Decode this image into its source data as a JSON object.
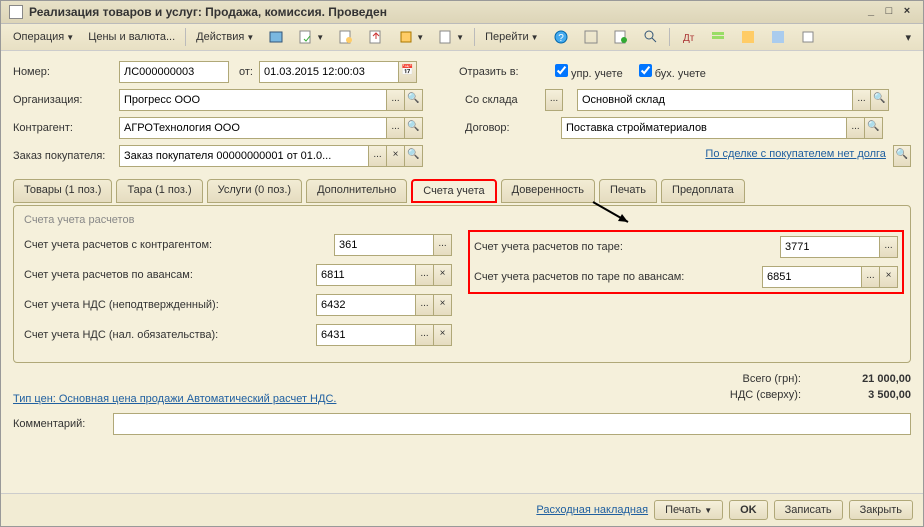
{
  "title": "Реализация товаров и услуг: Продажа, комиссия. Проведен",
  "toolbar": {
    "operation": "Операция",
    "prices": "Цены и валюта...",
    "actions": "Действия",
    "goto": "Перейти"
  },
  "header": {
    "number_label": "Номер:",
    "number": "ЛС000000003",
    "from_label": "от:",
    "date": "01.03.2015 12:00:03",
    "reflect_label": "Отразить в:",
    "mgmt_label": "упр. учете",
    "acc_label": "бух. учете",
    "org_label": "Организация:",
    "org": "Прогресс ООО",
    "warehouse_label": "Со склада",
    "warehouse": "Основной склад",
    "contractor_label": "Контрагент:",
    "contractor": "АГРОТехнология ООО",
    "contract_label": "Договор:",
    "contract": "Поставка стройматериалов",
    "order_label": "Заказ покупателя:",
    "order": "Заказ покупателя 00000000001 от 01.0...",
    "deal_link": "По сделке с покупателем нет долга"
  },
  "tabs": {
    "goods": "Товары (1 поз.)",
    "tare": "Тара (1 поз.)",
    "services": "Услуги (0 поз.)",
    "extra": "Дополнительно",
    "accounts": "Счета учета",
    "attorney": "Доверенность",
    "print": "Печать",
    "prepay": "Предоплата"
  },
  "panel": {
    "title": "Счета учета расчетов",
    "acc_contractor_label": "Счет учета расчетов с контрагентом:",
    "acc_contractor": "361",
    "acc_advance_label": "Счет учета расчетов по авансам:",
    "acc_advance": "6811",
    "acc_vat_unconf_label": "Счет учета НДС (неподтвержденный):",
    "acc_vat_unconf": "6432",
    "acc_vat_tax_label": "Счет учета НДС (нал. обязательства):",
    "acc_vat_tax": "6431",
    "acc_tare_label": "Счет учета расчетов по таре:",
    "acc_tare": "3771",
    "acc_tare_adv_label": "Счет учета расчетов по таре по авансам:",
    "acc_tare_adv": "6851"
  },
  "footer": {
    "price_info": "Тип цен: Основная цена продажи Автоматический расчет НДС.",
    "total_label": "Всего (грн):",
    "total": "21 000,00",
    "vat_label": "НДС (сверху):",
    "vat": "3 500,00",
    "comment_label": "Комментарий:"
  },
  "bottom": {
    "invoice": "Расходная накладная",
    "print": "Печать",
    "ok": "OK",
    "save": "Записать",
    "close": "Закрыть"
  }
}
